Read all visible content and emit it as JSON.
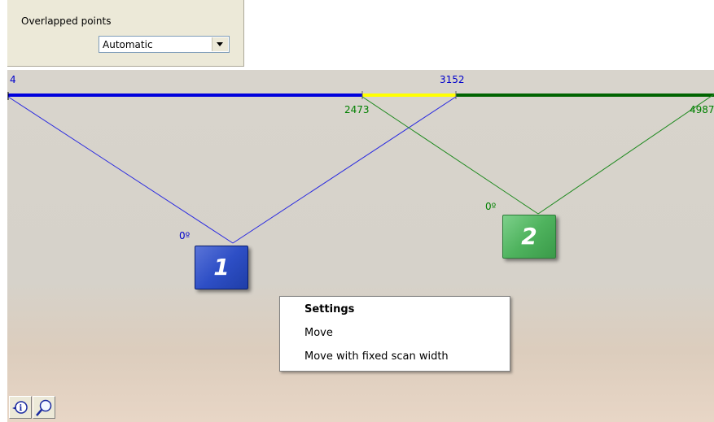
{
  "panel": {
    "label": "Overlapped points",
    "combo_value": "Automatic"
  },
  "axis": {
    "blue_start": "4",
    "blue_end": "3152",
    "green_start": "2473",
    "green_end": "4987"
  },
  "probes": [
    {
      "number": "1",
      "angle": "0º",
      "color": "#3050c8"
    },
    {
      "number": "2",
      "angle": "0º",
      "color": "#4caf5a"
    }
  ],
  "context_menu": {
    "items": [
      "Settings",
      "Move",
      "Move with fixed scan width"
    ]
  },
  "toolbar": {
    "info_icon": "info-pointer-icon",
    "zoom_icon": "magnifier-icon"
  },
  "colors": {
    "blue": "#0000dd",
    "yellow": "#ffff00",
    "green": "#006400"
  }
}
